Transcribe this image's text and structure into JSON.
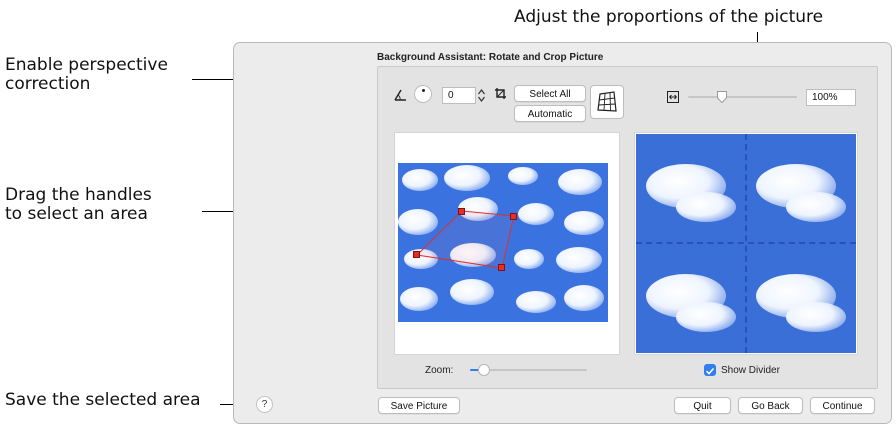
{
  "annotations": {
    "perspective": "Enable perspective\ncorrection",
    "handles": "Drag the handles\nto select an area",
    "save": "Save the selected area",
    "proportions": "Adjust the proportions of the picture"
  },
  "dialog": {
    "title": "Background Assistant: Rotate and Crop Picture",
    "rotation_value": "0",
    "select_all_label": "Select All",
    "automatic_label": "Automatic",
    "proportion_value": "100%",
    "proportion_slider_level": 0.31,
    "zoom_label": "Zoom:",
    "zoom_slider_level": 0.12,
    "show_divider_label": "Show Divider",
    "show_divider_checked": true,
    "help_label": "?",
    "save_picture_label": "Save Picture",
    "quit_label": "Quit",
    "go_back_label": "Go Back",
    "continue_label": "Continue"
  },
  "colors": {
    "accent": "#2f7ff0",
    "selection": "#e0302a",
    "sky": "#3a73df"
  },
  "icons": [
    "angle-icon",
    "rotation-dial-icon",
    "stepper-icon",
    "crop-icon",
    "perspective-grid-icon",
    "proportion-icon",
    "help-icon",
    "checkbox-icon"
  ]
}
